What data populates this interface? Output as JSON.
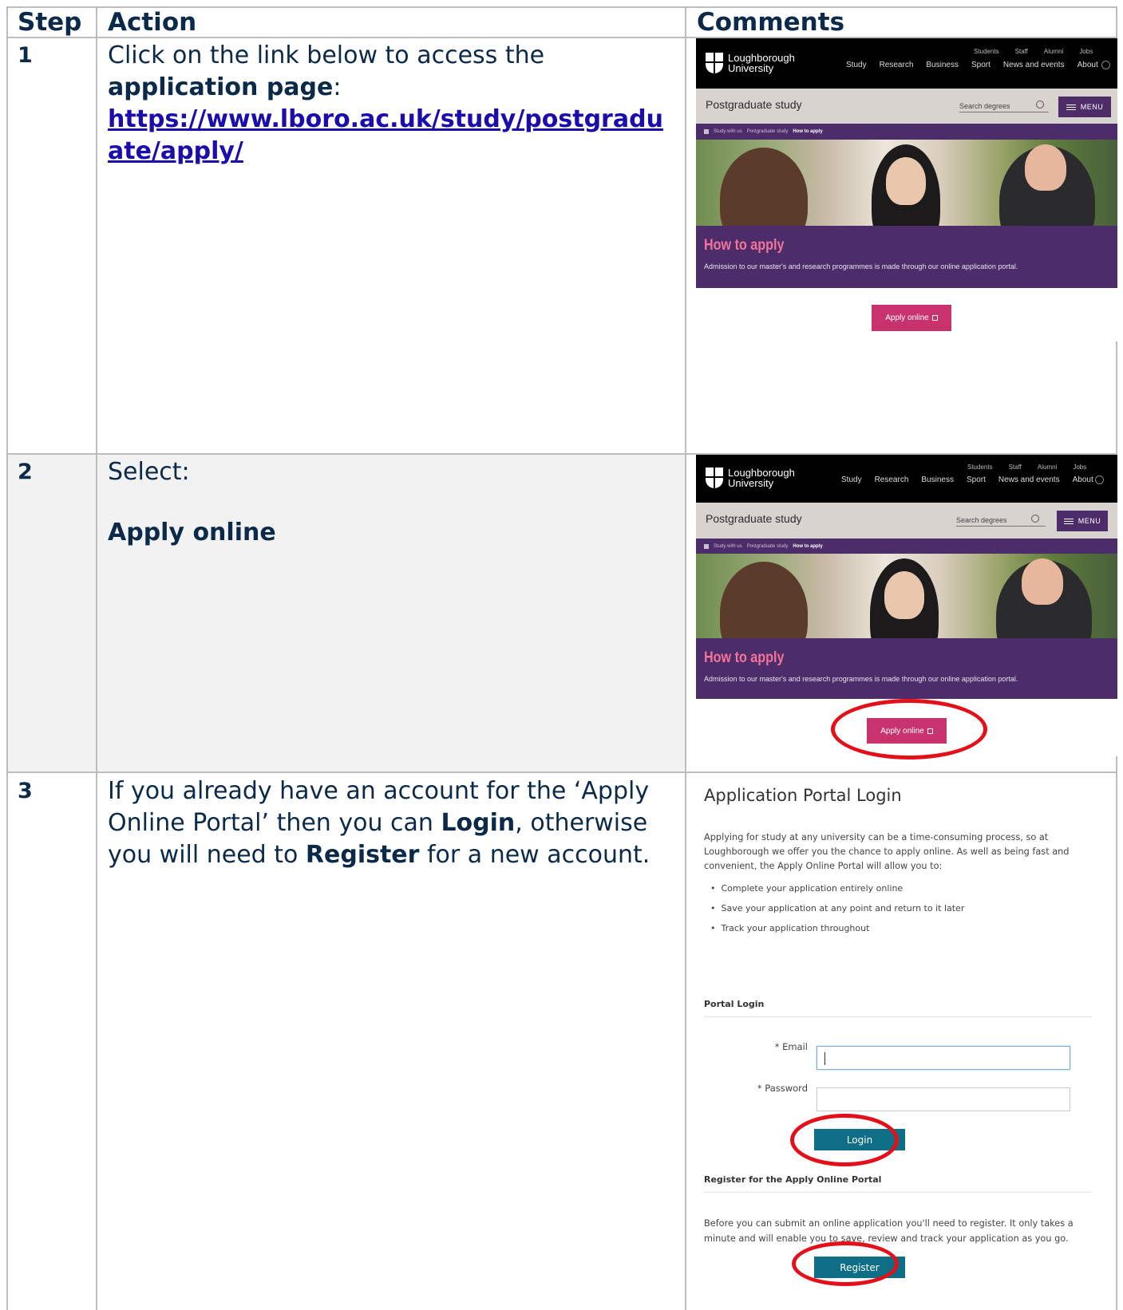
{
  "table": {
    "headers": {
      "step": "Step",
      "action": "Action",
      "comments": "Comments"
    }
  },
  "rows": [
    {
      "step": "1",
      "action_prefix": "Click on the link below to access the ",
      "action_bold": "application page",
      "action_suffix": ":",
      "link": "https://www.lboro.ac.uk/study/postgraduate/apply/"
    },
    {
      "step": "2",
      "action_prefix": "Select:",
      "action_bold": "Apply online"
    },
    {
      "step": "3",
      "action_part1": "If you already have an account for the ‘Apply Online Portal’ then you can ",
      "action_bold1": "Login",
      "action_part2": ", otherwise you will need to ",
      "action_bold2": "Register",
      "action_part3": " for a new account."
    }
  ],
  "website": {
    "logo_line1": "Loughborough",
    "logo_line2": "University",
    "utility_links": [
      "Students",
      "Staff",
      "Alumni",
      "Jobs"
    ],
    "nav_links": [
      "Study",
      "Research",
      "Business",
      "Sport",
      "News and events",
      "About"
    ],
    "section_title": "Postgraduate study",
    "search_placeholder": "Search degrees",
    "menu_label": "MENU",
    "breadcrumb": [
      "Study with us",
      "Postgraduate study",
      "How to apply"
    ],
    "hero_title": "How to apply",
    "hero_subtitle": "Admission to our master's and research programmes is made through our online application portal.",
    "apply_button": "Apply online"
  },
  "portal": {
    "title": "Application Portal Login",
    "intro": "Applying for study at any university can be a time-consuming process, so at Loughborough we offer you the chance to apply online. As well as being fast and convenient, the Apply Online Portal will allow you to:",
    "bullets": [
      "Complete your application entirely online",
      "Save your application at any point and return to it later",
      "Track your application throughout"
    ],
    "login_heading": "Portal Login",
    "email_label": "* Email",
    "password_label": "* Password",
    "login_button": "Login",
    "register_heading": "Register for the Apply Online Portal",
    "register_text": "Before you can submit an online application you'll need to register. It only takes a minute and will enable you to save, review and track your application as you go.",
    "register_button": "Register"
  },
  "colors": {
    "header_text": "#0b2a4a",
    "highlight_ring": "#e3101a",
    "site_purple": "#4d2d69",
    "apply_pink": "#c8336e",
    "portal_button": "#0d6e86"
  }
}
